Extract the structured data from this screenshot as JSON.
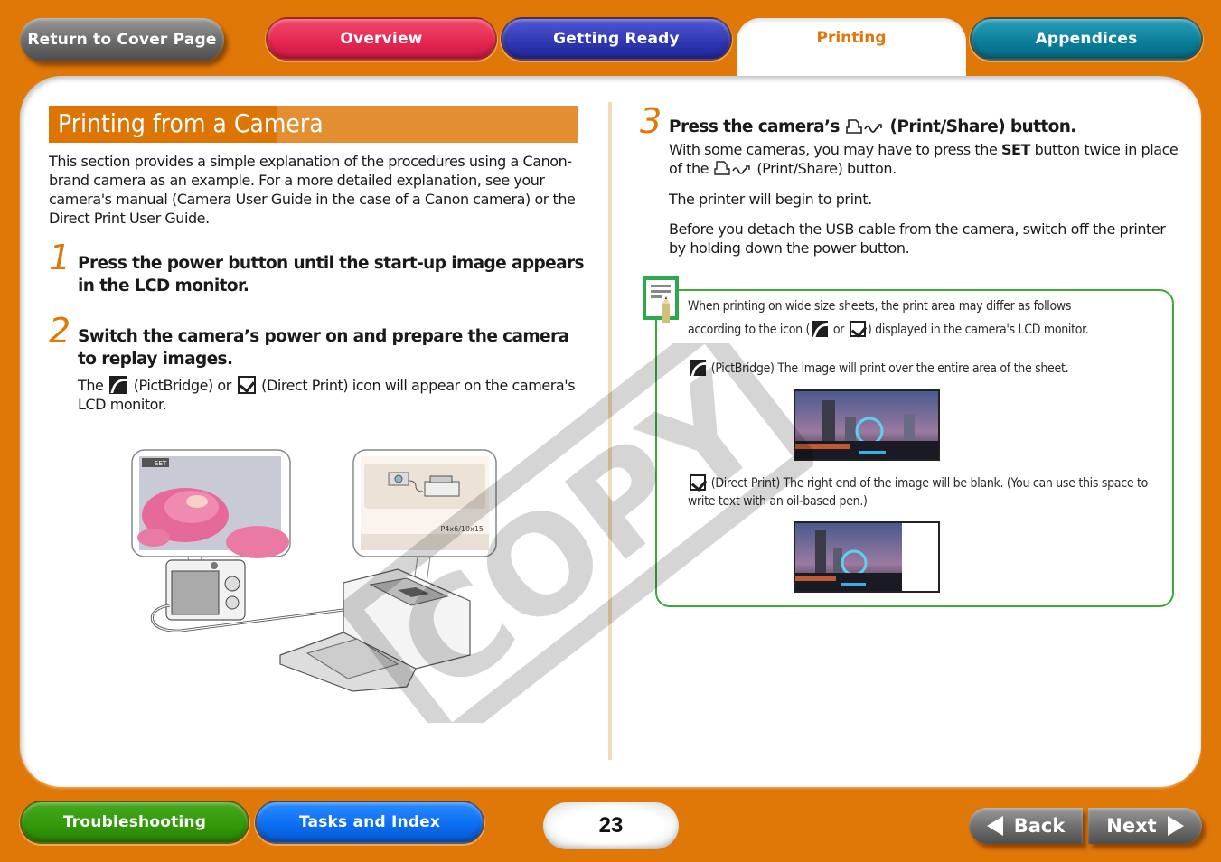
{
  "top_nav": {
    "return_label": "Return to Cover Page",
    "tabs": [
      {
        "label": "Overview",
        "color": "#e52550",
        "active": false
      },
      {
        "label": "Getting Ready",
        "color": "#2e36b0",
        "active": false
      },
      {
        "label": "Printing",
        "color": "#e07808",
        "active": true
      },
      {
        "label": "Appendices",
        "color": "#0a7c98",
        "active": false
      }
    ]
  },
  "section": {
    "title": "Printing from a Camera",
    "intro": "This section provides a simple explanation of the procedures using a Canon-brand camera as an example. For a more detailed explanation, see your camera's manual (Camera User Guide in the case of a Canon camera) or the Direct Print User Guide."
  },
  "steps": [
    {
      "number": "1",
      "title": "Press the power button until the start-up image appears in the LCD monitor."
    },
    {
      "number": "2",
      "title": "Switch the camera’s power on and prepare the camera to replay images.",
      "desc_pre": "The",
      "desc_pb": "(PictBridge) or",
      "desc_dp": "(Direct Print) icon will appear on the camera's LCD monitor."
    },
    {
      "number": "3",
      "title_pre": "Press the camera’s",
      "title_post": "(Print/Share) button.",
      "desc1_pre": "With some cameras, you may have to press the",
      "desc1_bold": "SET",
      "desc1_mid": "button twice in place of the",
      "desc1_post": "(Print/Share) button.",
      "desc2": "The printer will begin to print.",
      "desc3": "Before you detach the USB cable from the camera, switch off the printer by holding down the power button."
    }
  ],
  "illustration": {
    "camera_screen_badge": "SET",
    "printer_screen_label": "P4x6/10x15"
  },
  "note": {
    "intro_1": "When printing on wide size sheets, the print area may differ as follows",
    "intro_2_pre": "according to the icon (",
    "intro_2_or": "or",
    "intro_2_post": ") displayed in the camera's LCD monitor.",
    "pictbridge": "(PictBridge) The image will print over the entire area of the sheet.",
    "direct_print": "(Direct Print) The right end of the image will be blank. (You can use this space to write text with an oil-based pen.)"
  },
  "watermark": "COPY",
  "bottom_nav": {
    "troubleshooting_label": "Troubleshooting",
    "tasks_label": "Tasks and Index",
    "page_number": "23",
    "back_label": "Back",
    "next_label": "Next"
  }
}
